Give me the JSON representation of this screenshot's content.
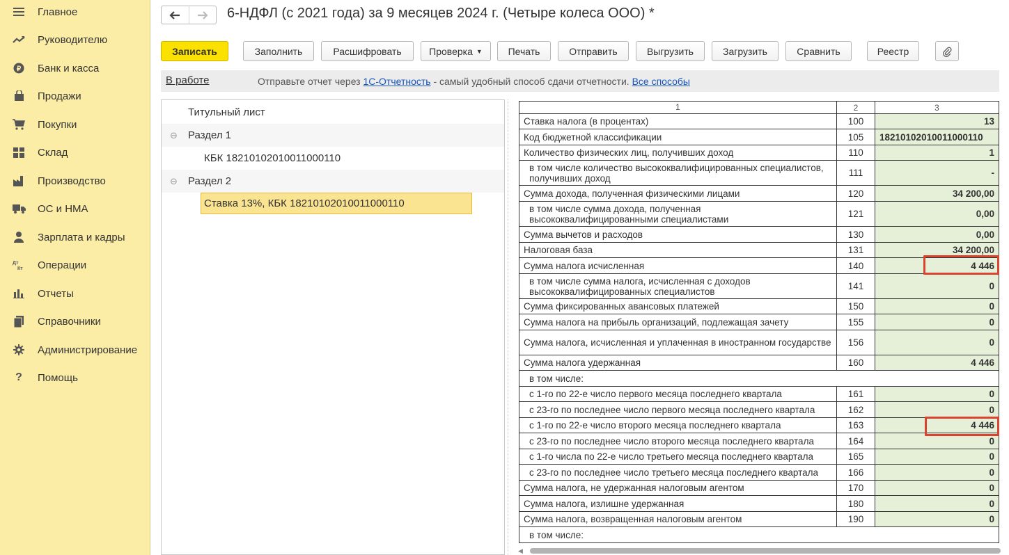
{
  "sidebar": {
    "items": [
      {
        "label": "Главное",
        "icon": "menu-icon"
      },
      {
        "label": "Руководителю",
        "icon": "trend-icon"
      },
      {
        "label": "Банк и касса",
        "icon": "ruble-icon"
      },
      {
        "label": "Продажи",
        "icon": "bag-icon"
      },
      {
        "label": "Покупки",
        "icon": "cart-icon"
      },
      {
        "label": "Склад",
        "icon": "warehouse-icon"
      },
      {
        "label": "Производство",
        "icon": "factory-icon"
      },
      {
        "label": "ОС и НМА",
        "icon": "truck-icon"
      },
      {
        "label": "Зарплата и кадры",
        "icon": "person-icon"
      },
      {
        "label": "Операции",
        "icon": "dt-kt-icon"
      },
      {
        "label": "Отчеты",
        "icon": "bar-chart-icon"
      },
      {
        "label": "Справочники",
        "icon": "books-icon"
      },
      {
        "label": "Администрирование",
        "icon": "gear-icon"
      },
      {
        "label": "Помощь",
        "icon": "help-icon"
      }
    ]
  },
  "header": {
    "back_glyph": "🡐",
    "forward_glyph": "🡒",
    "title": "6-НДФЛ (с 2021 года) за 9 месяцев 2024 г. (Четыре колеса ООО) *"
  },
  "toolbar": {
    "save": "Записать",
    "fill": "Заполнить",
    "decode": "Расшифровать",
    "check": "Проверка",
    "print": "Печать",
    "send": "Отправить",
    "export": "Выгрузить",
    "import": "Загрузить",
    "compare": "Сравнить",
    "registry": "Реестр",
    "attach_glyph": "📎"
  },
  "infobar": {
    "status": "В работе",
    "text_before": "Отправьте отчет через ",
    "link_service": "1С-Отчетность",
    "text_after": " - самый удобный способ сдачи отчетности. ",
    "link_all": "Все способы"
  },
  "tree": {
    "items": [
      {
        "label": "Титульный лист"
      },
      {
        "label": "Раздел 1",
        "toggle": "⊖"
      },
      {
        "label": "КБК 18210102010011000110"
      },
      {
        "label": "Раздел 2",
        "toggle": "⊖"
      },
      {
        "label": "Ставка 13%, КБК 18210102010011000110"
      }
    ]
  },
  "report": {
    "header": {
      "c1": "1",
      "c2": "2",
      "c3": "3"
    },
    "rows": [
      {
        "label": "Ставка налога (в процентах)",
        "code": "100",
        "value": "13"
      },
      {
        "label": "Код бюджетной классификации",
        "code": "105",
        "value": "18210102010011000110"
      },
      {
        "label": "Количество физических лиц, получивших доход",
        "code": "110",
        "value": "1"
      },
      {
        "label": "в том числе количество высококвалифицированных специалистов, получивших доход",
        "code": "111",
        "value": "-"
      },
      {
        "label": "Сумма дохода, полученная физическими лицами",
        "code": "120",
        "value": "34 200,00"
      },
      {
        "label": "в том числе сумма дохода, полученная высококвалифицированными специалистами",
        "code": "121",
        "value": "0,00"
      },
      {
        "label": "Сумма вычетов и расходов",
        "code": "130",
        "value": "0,00"
      },
      {
        "label": "Налоговая база",
        "code": "131",
        "value": "34 200,00"
      },
      {
        "label": "Сумма налога исчисленная",
        "code": "140",
        "value": "4 446"
      },
      {
        "label": "в том числе сумма налога, исчисленная с доходов высококвалифицированных специалистов",
        "code": "141",
        "value": "0"
      },
      {
        "label": "Сумма фиксированных авансовых платежей",
        "code": "150",
        "value": "0"
      },
      {
        "label": "Сумма налога на прибыль организаций, подлежащая зачету",
        "code": "155",
        "value": "0"
      },
      {
        "label": "Сумма налога, исчисленная и уплаченная в иностранном государстве",
        "code": "156",
        "value": "0"
      },
      {
        "label": "Сумма налога удержанная",
        "code": "160",
        "value": "4 446"
      },
      {
        "label": "в том числе:"
      },
      {
        "label": "с 1-го по 22-е число первого месяца последнего квартала",
        "code": "161",
        "value": "0"
      },
      {
        "label": "с 23-го по последнее число первого месяца последнего квартала",
        "code": "162",
        "value": "0"
      },
      {
        "label": "с 1-го по 22-е число второго месяца последнего квартала",
        "code": "163",
        "value": "4 446"
      },
      {
        "label": "с 23-го по последнее число второго месяца последнего квартала",
        "code": "164",
        "value": "0"
      },
      {
        "label": "с 1-го числа по 22-е число третьего месяца последнего квартала",
        "code": "165",
        "value": "0"
      },
      {
        "label": "с 23-го по последнее число третьего месяца последнего квартала",
        "code": "166",
        "value": "0"
      },
      {
        "label": "Сумма налога, не удержанная налоговым агентом",
        "code": "170",
        "value": "0"
      },
      {
        "label": "Сумма налога, излишне удержанная",
        "code": "180",
        "value": "0"
      },
      {
        "label": "Сумма налога, возвращенная налоговым агентом",
        "code": "190",
        "value": "0"
      },
      {
        "label": "в том числе:"
      }
    ]
  },
  "colors": {
    "sidebar_bg": "#fbeca6",
    "primary_button": "#fbe100",
    "value_cell_bg": "#e6f0d9",
    "highlight_border": "#d9432f",
    "selected_tree_item": "#fbe491"
  }
}
